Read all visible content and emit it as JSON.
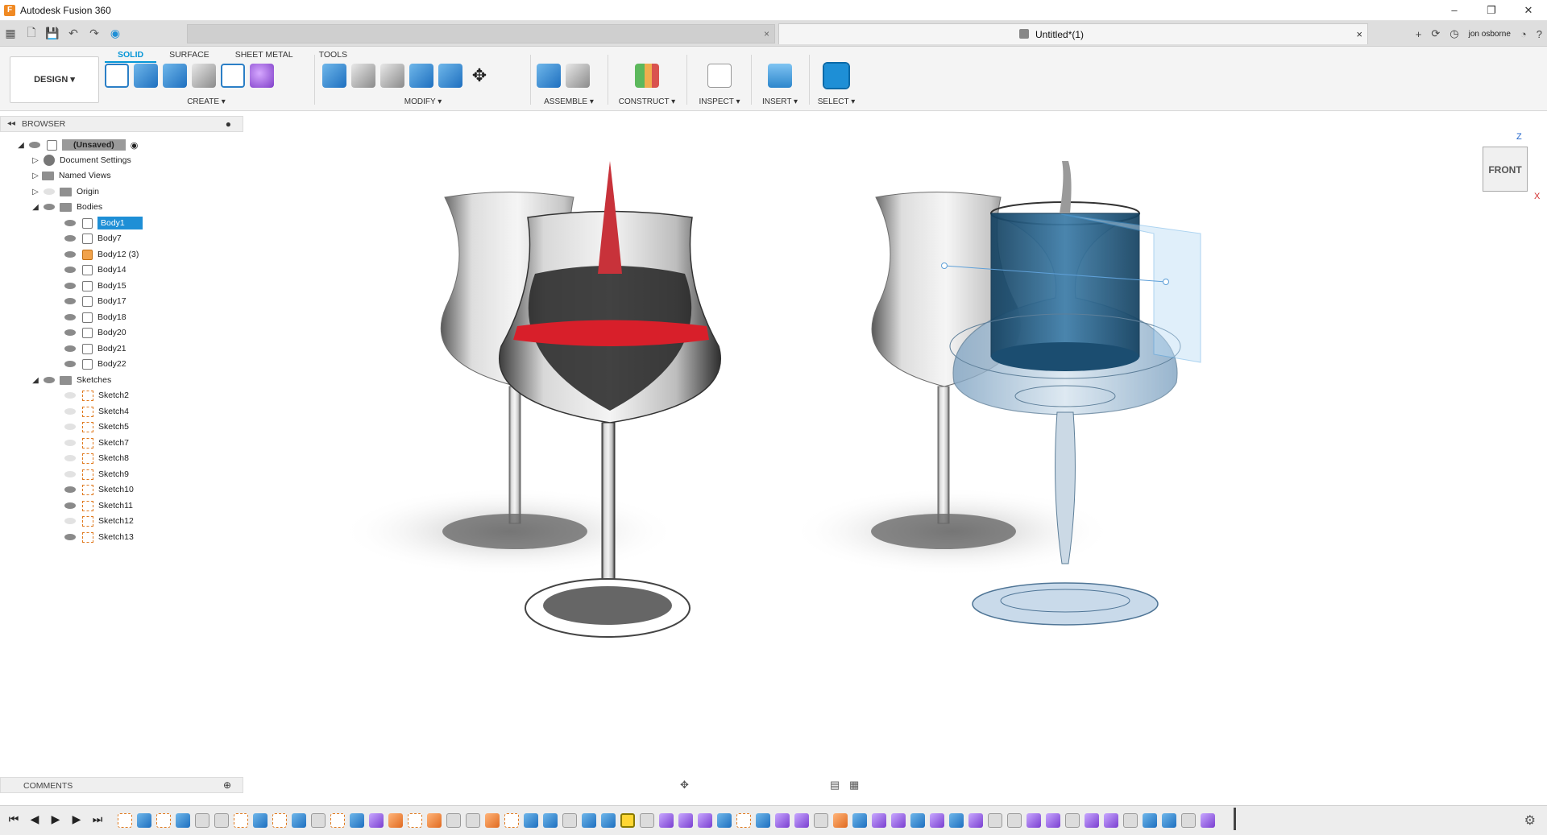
{
  "window": {
    "title": "Autodesk Fusion 360",
    "logo_letter": "F"
  },
  "qat": {
    "document_tab": "Untitled*(1)",
    "user": "jon osborne",
    "close": "×"
  },
  "ribbon": {
    "workspace": "DESIGN ▾",
    "tabs": [
      "SOLID",
      "SURFACE",
      "SHEET METAL",
      "TOOLS"
    ],
    "groups": {
      "create": "CREATE ▾",
      "modify": "MODIFY ▾",
      "assemble": "ASSEMBLE ▾",
      "construct": "CONSTRUCT ▾",
      "inspect": "INSPECT ▾",
      "insert": "INSERT ▾",
      "select": "SELECT ▾"
    }
  },
  "browser": {
    "header": "BROWSER",
    "root": "(Unsaved)",
    "items": [
      {
        "label": "Document Settings"
      },
      {
        "label": "Named Views"
      },
      {
        "label": "Origin"
      },
      {
        "label": "Bodies"
      },
      {
        "label": "Body1"
      },
      {
        "label": "Body7"
      },
      {
        "label": "Body12 (3)"
      },
      {
        "label": "Body14"
      },
      {
        "label": "Body15"
      },
      {
        "label": "Body17"
      },
      {
        "label": "Body18"
      },
      {
        "label": "Body20"
      },
      {
        "label": "Body21"
      },
      {
        "label": "Body22"
      },
      {
        "label": "Sketches"
      },
      {
        "label": "Sketch2"
      },
      {
        "label": "Sketch4"
      },
      {
        "label": "Sketch5"
      },
      {
        "label": "Sketch7"
      },
      {
        "label": "Sketch8"
      },
      {
        "label": "Sketch9"
      },
      {
        "label": "Sketch10"
      },
      {
        "label": "Sketch11"
      },
      {
        "label": "Sketch12"
      },
      {
        "label": "Sketch13"
      }
    ]
  },
  "comments": {
    "header": "COMMENTS"
  },
  "viewcube": {
    "face": "FRONT",
    "z": "Z",
    "x": "X"
  },
  "colors": {
    "accent": "#0696d7",
    "selection": "#1e8fd6",
    "wine": "#d81f2a"
  }
}
